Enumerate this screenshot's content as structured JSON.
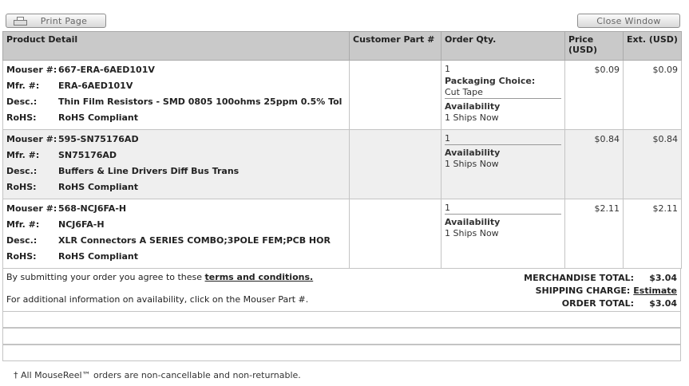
{
  "toolbar": {
    "print_label": "Print Page",
    "close_label": "Close Window"
  },
  "table": {
    "headers": {
      "product_detail": "Product Detail",
      "customer_part": "Customer Part #",
      "order_qty": "Order Qty.",
      "price": "Price (USD)",
      "ext": "Ext. (USD)"
    },
    "labels": {
      "mouser": "Mouser #:",
      "mfr": "Mfr. #:",
      "desc": "Desc.:",
      "rohs": "RoHS:"
    },
    "items": [
      {
        "mouser": "667-ERA-6AED101V",
        "mfr": "ERA-6AED101V",
        "desc": "Thin Film Resistors - SMD 0805 100ohms 25ppm 0.5% Tol",
        "rohs": "RoHS Compliant",
        "qty": "1",
        "packaging_label": "Packaging Choice:",
        "packaging_value": "Cut Tape",
        "availability_label": "Availability",
        "availability": "1 Ships Now",
        "price": "$0.09",
        "ext": "$0.09"
      },
      {
        "mouser": "595-SN75176AD",
        "mfr": "SN75176AD",
        "desc": "Buffers & Line Drivers Diff Bus Trans",
        "rohs": "RoHS Compliant",
        "qty": "1",
        "availability_label": "Availability",
        "availability": "1 Ships Now",
        "price": "$0.84",
        "ext": "$0.84"
      },
      {
        "mouser": "568-NCJ6FA-H",
        "mfr": "NCJ6FA-H",
        "desc": "XLR Connectors A SERIES COMBO;3POLE FEM;PCB HOR",
        "rohs": "RoHS Compliant",
        "qty": "1",
        "availability_label": "Availability",
        "availability": "1 Ships Now",
        "price": "$2.11",
        "ext": "$2.11"
      }
    ]
  },
  "totals": {
    "terms_prefix": "By submitting your order you agree to these",
    "terms_link": "terms and conditions.",
    "availability_note": "For additional information on availability, click on the Mouser Part #.",
    "merch_label": "MERCHANDISE TOTAL:",
    "merch_value": "$3.04",
    "shipping_label": "SHIPPING CHARGE:",
    "shipping_value": "Estimate",
    "order_label": "ORDER TOTAL:",
    "order_value": "$3.04"
  },
  "footnote": "† All MouseReel™ orders are non-cancellable and non-returnable."
}
